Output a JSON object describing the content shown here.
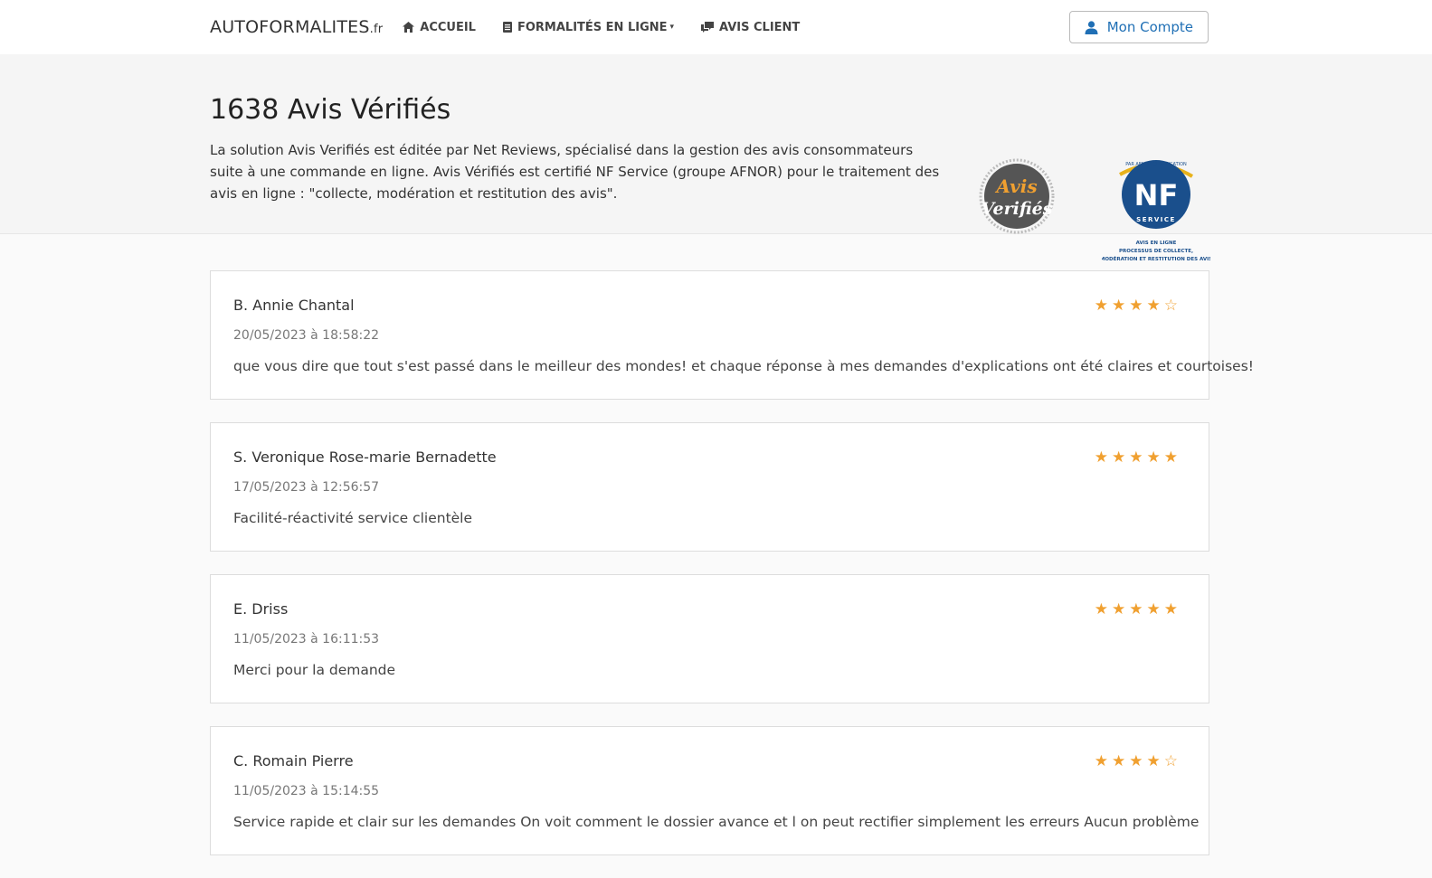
{
  "nav": {
    "brand_main": "AUTOFORMALITES",
    "brand_tld": ".fr",
    "links": [
      {
        "label": "ACCUEIL",
        "icon": "home-icon"
      },
      {
        "label": "FORMALITÉS EN LIGNE",
        "icon": "document-icon",
        "caret": "▾"
      },
      {
        "label": "AVIS CLIENT",
        "icon": "chat-icon"
      }
    ],
    "account_label": "Mon Compte"
  },
  "hero": {
    "title": "1638 Avis Vérifiés",
    "description": "La solution Avis Verifiés est éditée par Net Reviews, spécialisé dans la gestion des avis consommateurs suite à une commande en ligne. Avis Vérifiés est certifié NF Service (groupe AFNOR) pour le traitement des avis en ligne : \"collecte, modération et restitution des avis\"."
  },
  "logos": {
    "avis_line1": "Avis",
    "avis_line2": "Verifiés",
    "nf_main": "NF",
    "nf_arc_top": "PAR AFNOR CERTIFICATION",
    "nf_arc_bottom": "SERVICE",
    "nf_caption1": "AVIS EN LIGNE",
    "nf_caption2": "PROCESSUS DE COLLECTE,",
    "nf_caption3": "MODÉRATION ET RESTITUTION DES AVIS"
  },
  "reviews": [
    {
      "author": "B. Annie Chantal",
      "date": "20/05/2023 à 18:58:22",
      "text": "que vous dire que tout s'est passé dans le meilleur des mondes! et chaque réponse à mes demandes d'explications ont été claires et courtoises!",
      "stars": "★★★★☆",
      "rating": 4
    },
    {
      "author": "S. Veronique Rose-marie Bernadette",
      "date": "17/05/2023 à 12:56:57",
      "text": "Facilité-réactivité service clientèle",
      "stars": "★★★★★",
      "rating": 5
    },
    {
      "author": "E. Driss",
      "date": "11/05/2023 à 16:11:53",
      "text": "Merci pour la demande",
      "stars": "★★★★★",
      "rating": 5
    },
    {
      "author": "C. Romain Pierre",
      "date": "11/05/2023 à 15:14:55",
      "text": "Service rapide et clair sur les demandes On voit comment le dossier avance et l on peut rectifier simplement les erreurs Aucun problème",
      "stars": "★★★★☆",
      "rating": 4
    }
  ],
  "colors": {
    "accent": "#1f6fb5",
    "star": "#f0a030",
    "nf_blue": "#1a4f8c",
    "nf_gold": "#e8b21b"
  }
}
